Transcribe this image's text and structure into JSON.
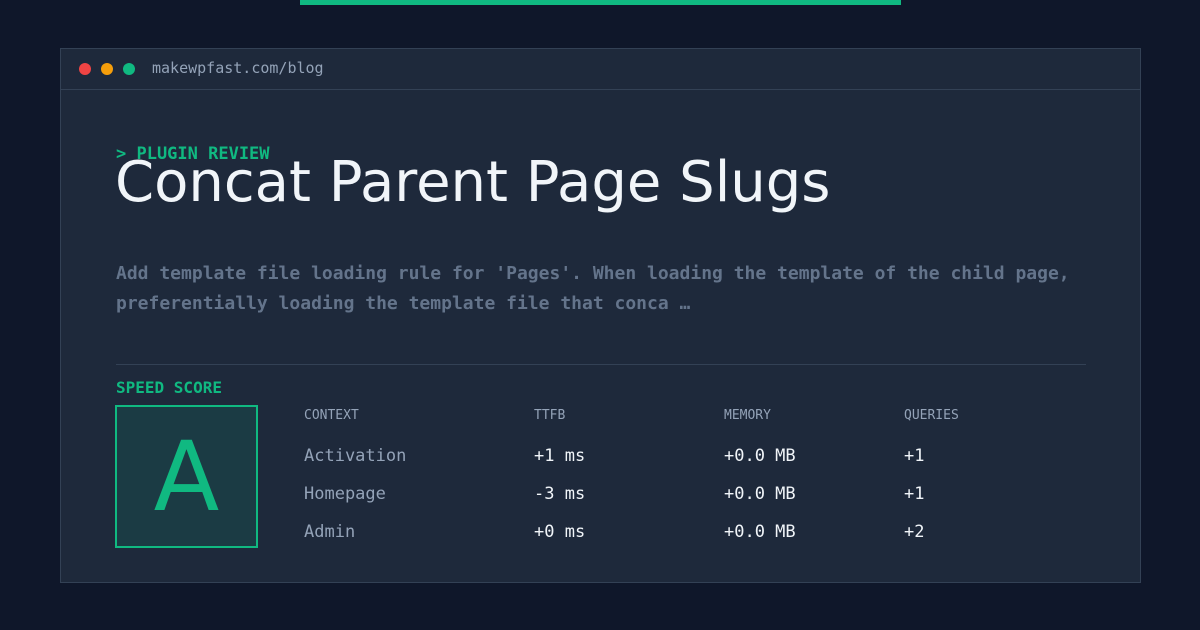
{
  "colors": {
    "accent": "#10b981",
    "dot_close": "#ef4444",
    "dot_min": "#f59e0b",
    "dot_max": "#10b981"
  },
  "window": {
    "url": "makewpfast.com/blog"
  },
  "article": {
    "kicker": "> PLUGIN REVIEW",
    "title": "Concat Parent Page Slugs",
    "description": "Add template file loading rule for 'Pages'. When loading the template of the child page, preferentially loading the template file that conca …"
  },
  "speed": {
    "label": "SPEED SCORE",
    "grade": "A",
    "columns": [
      "CONTEXT",
      "TTFB",
      "MEMORY",
      "QUERIES"
    ],
    "rows": [
      {
        "context": "Activation",
        "ttfb": "+1 ms",
        "memory": "+0.0 MB",
        "queries": "+1"
      },
      {
        "context": "Homepage",
        "ttfb": "-3 ms",
        "memory": "+0.0 MB",
        "queries": "+1"
      },
      {
        "context": "Admin",
        "ttfb": "+0 ms",
        "memory": "+0.0 MB",
        "queries": "+2"
      }
    ]
  }
}
